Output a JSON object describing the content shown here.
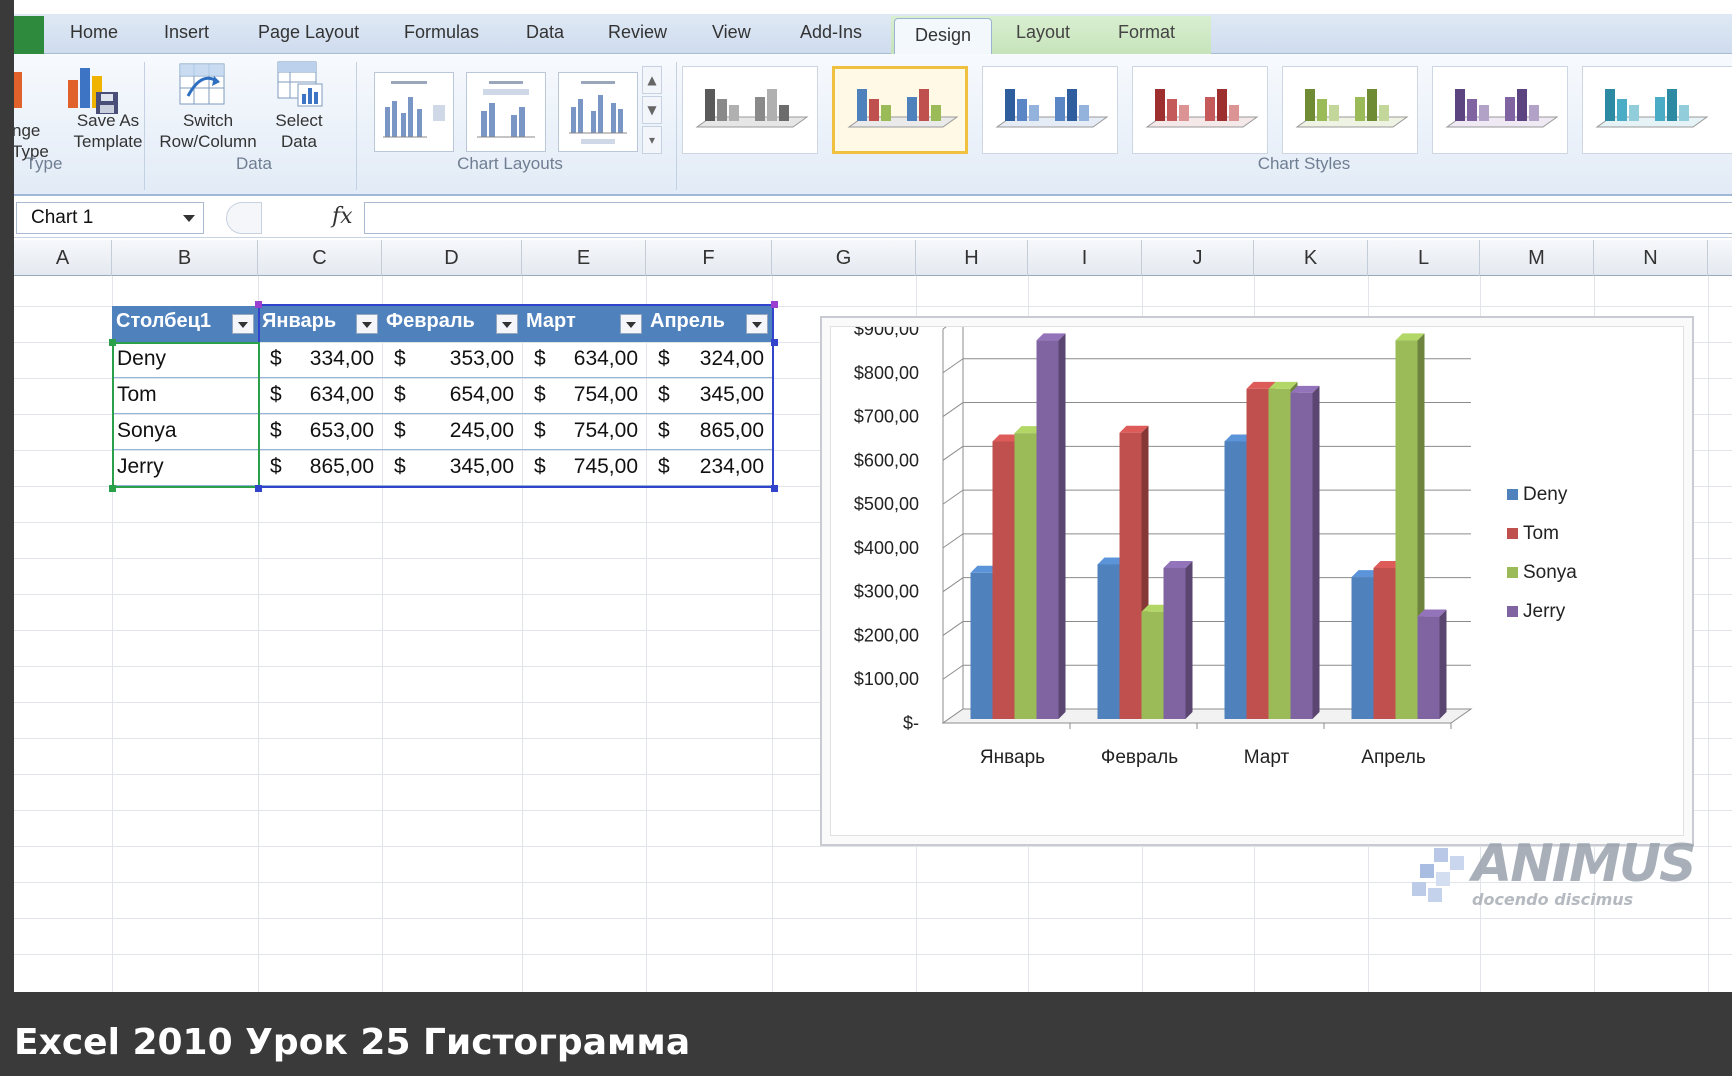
{
  "ribbon": {
    "tabs": [
      "Home",
      "Insert",
      "Page Layout",
      "Formulas",
      "Data",
      "Review",
      "View",
      "Add-Ins",
      "Design",
      "Layout",
      "Format"
    ],
    "active_tab": "Design",
    "groups": {
      "type": {
        "label": "Type",
        "change_type_line1": "nge",
        "change_type_line2": "Type",
        "save_template_line1": "Save As",
        "save_template_line2": "Template"
      },
      "data": {
        "label": "Data",
        "switch_line1": "Switch",
        "switch_line2": "Row/Column",
        "select_line1": "Select",
        "select_line2": "Data"
      },
      "layouts": {
        "label": "Chart Layouts"
      },
      "styles": {
        "label": "Chart Styles",
        "selected_index": 1
      }
    }
  },
  "formula_bar": {
    "name_box": "Chart 1",
    "fx": "fx",
    "formula": ""
  },
  "columns": [
    "A",
    "B",
    "C",
    "D",
    "E",
    "F",
    "G",
    "H",
    "I",
    "J",
    "K",
    "L",
    "M",
    "N"
  ],
  "table": {
    "headers": [
      "Столбец1",
      "Январь",
      "Февраль",
      "Март",
      "Апрель"
    ],
    "currency": "$",
    "rows": [
      {
        "name": "Deny",
        "values": [
          "334,00",
          "353,00",
          "634,00",
          "324,00"
        ]
      },
      {
        "name": "Tom",
        "values": [
          "634,00",
          "654,00",
          "754,00",
          "345,00"
        ]
      },
      {
        "name": "Sonya",
        "values": [
          "653,00",
          "245,00",
          "754,00",
          "865,00"
        ]
      },
      {
        "name": "Jerry",
        "values": [
          "865,00",
          "345,00",
          "745,00",
          "234,00"
        ]
      }
    ]
  },
  "chart_data": {
    "type": "bar",
    "categories": [
      "Январь",
      "Февраль",
      "Март",
      "Апрель"
    ],
    "series": [
      {
        "name": "Deny",
        "color": "#4f81bd",
        "values": [
          334,
          353,
          634,
          324
        ]
      },
      {
        "name": "Tom",
        "color": "#c0504d",
        "values": [
          634,
          654,
          754,
          345
        ]
      },
      {
        "name": "Sonya",
        "color": "#9bbb59",
        "values": [
          653,
          245,
          754,
          865
        ]
      },
      {
        "name": "Jerry",
        "color": "#8064a2",
        "values": [
          865,
          345,
          745,
          234
        ]
      }
    ],
    "yticks": [
      "$-",
      "$100,00",
      "$200,00",
      "$300,00",
      "$400,00",
      "$500,00",
      "$600,00",
      "$700,00",
      "$800,00",
      "$900,00"
    ],
    "ylim": [
      0,
      900
    ],
    "grid": true,
    "legend": "right"
  },
  "watermark": {
    "brand": "ANIMUS",
    "tagline": "docendo discimus"
  },
  "caption": "Excel 2010 Урок 25 Гистограмма"
}
